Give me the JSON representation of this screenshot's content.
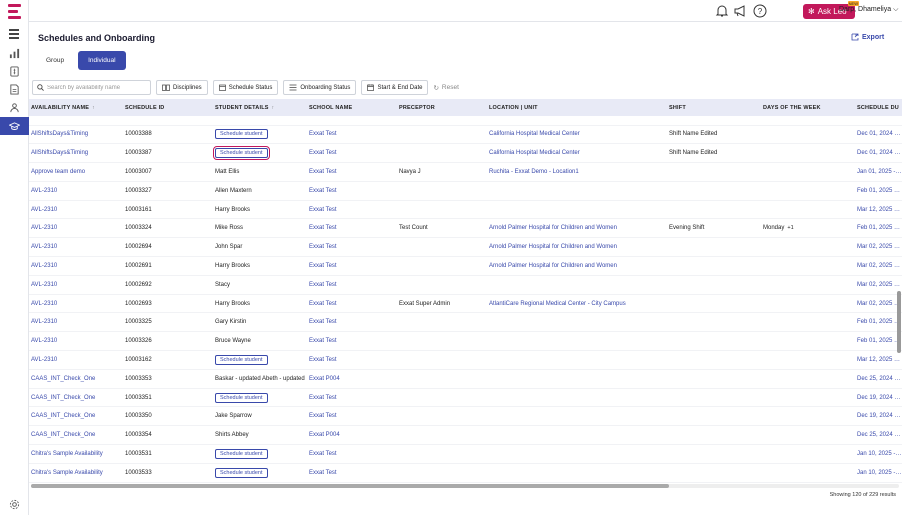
{
  "header": {
    "ask_leo_label": "Ask Leo",
    "ask_leo_badge": "NEW",
    "user_name": "Darp, Dhameliya"
  },
  "page": {
    "title": "Schedules and Onboarding",
    "export_label": "Export"
  },
  "tabs": [
    {
      "label": "Group",
      "active": false
    },
    {
      "label": "Individual",
      "active": true
    }
  ],
  "filters": {
    "search_placeholder": "Search by availability name",
    "disciplines": "Disciplines",
    "schedule_status": "Schedule Status",
    "onboarding_status": "Onboarding Status",
    "start_end_date": "Start & End Date",
    "reset": "Reset"
  },
  "table": {
    "columns": [
      "AVAILABILITY NAME",
      "SCHEDULE ID",
      "STUDENT DETAILS",
      "SCHOOL NAME",
      "PRECEPTOR",
      "LOCATION | UNIT",
      "SHIFT",
      "DAYS OF THE WEEK",
      "SCHEDULE DU"
    ],
    "schedule_button_label": "Schedule student",
    "rows": [
      {
        "availability": "AllShiftsDays&Timing",
        "id": "10003388",
        "student": "",
        "student_button": true,
        "focus": false,
        "school": "Exxat Test",
        "preceptor": "",
        "location": "California Hospital Medical Center",
        "shift": "Shift Name Edited",
        "days": "",
        "days_extra": "",
        "duration": "Dec 01, 2024 - Dec 31, 2024"
      },
      {
        "availability": "AllShiftsDays&Timing",
        "id": "10003387",
        "student": "",
        "student_button": true,
        "focus": true,
        "school": "Exxat Test",
        "preceptor": "",
        "location": "California Hospital Medical Center",
        "shift": "Shift Name Edited",
        "days": "",
        "days_extra": "",
        "duration": "Dec 01, 2024 - Dec 31, 2024"
      },
      {
        "availability": "Approve team demo",
        "id": "10003007",
        "student": "Matt Ellis",
        "student_button": false,
        "focus": false,
        "school": "Exxat Test",
        "preceptor": "Navya J",
        "location": "Ruchita - Exxat Demo - Location1",
        "shift": "",
        "days": "",
        "days_extra": "",
        "duration": "Jan 01, 2025 - Jan 31, 2025"
      },
      {
        "availability": "AVL-2310",
        "id": "10003327",
        "student": "Allen Maxtern",
        "student_button": false,
        "focus": false,
        "school": "Exxat Test",
        "preceptor": "",
        "location": "",
        "shift": "",
        "days": "",
        "days_extra": "",
        "duration": "Feb 01, 2025 - Feb 28, 2025"
      },
      {
        "availability": "AVL-2310",
        "id": "10003161",
        "student": "Harry Brooks",
        "student_button": false,
        "focus": false,
        "school": "Exxat Test",
        "preceptor": "",
        "location": "",
        "shift": "",
        "days": "",
        "days_extra": "",
        "duration": "Mar 12, 2025 - Apr 12, 2025"
      },
      {
        "availability": "AVL-2310",
        "id": "10003324",
        "student": "Mike Ross",
        "student_button": false,
        "focus": false,
        "school": "Exxat Test",
        "preceptor": "Test Count",
        "location": "Arnold Palmer Hospital for Children and Women",
        "shift": "Evening Shift",
        "days": "Monday",
        "days_extra": "+1",
        "duration": "Feb 01, 2025 - Feb 28, 2025"
      },
      {
        "availability": "AVL-2310",
        "id": "10002694",
        "student": "John Spar",
        "student_button": false,
        "focus": false,
        "school": "Exxat Test",
        "preceptor": "",
        "location": "Arnold Palmer Hospital for Children and Women",
        "shift": "",
        "days": "",
        "days_extra": "",
        "duration": "Mar 02, 2025 - Apr 02, 2025"
      },
      {
        "availability": "AVL-2310",
        "id": "10002691",
        "student": "Harry Brooks",
        "student_button": false,
        "focus": false,
        "school": "Exxat Test",
        "preceptor": "",
        "location": "Arnold Palmer Hospital for Children and Women",
        "shift": "",
        "days": "",
        "days_extra": "",
        "duration": "Mar 02, 2025 - Apr 02, 2025"
      },
      {
        "availability": "AVL-2310",
        "id": "10002692",
        "student": "Stacy",
        "student_button": false,
        "focus": false,
        "school": "Exxat Test",
        "preceptor": "",
        "location": "",
        "shift": "",
        "days": "",
        "days_extra": "",
        "duration": "Mar 02, 2025 - Apr 02, 2025"
      },
      {
        "availability": "AVL-2310",
        "id": "10002693",
        "student": "Harry Brooks",
        "student_button": false,
        "focus": false,
        "school": "Exxat Test",
        "preceptor": "Exxat Super Admin",
        "location": "AtlantiCare Regional Medical Center - City Campus",
        "shift": "",
        "days": "",
        "days_extra": "",
        "duration": "Mar 02, 2025 - Apr 02, 2025"
      },
      {
        "availability": "AVL-2310",
        "id": "10003325",
        "student": "Gary Kirstin",
        "student_button": false,
        "focus": false,
        "school": "Exxat Test",
        "preceptor": "",
        "location": "",
        "shift": "",
        "days": "",
        "days_extra": "",
        "duration": "Feb 01, 2025 - Feb 28, 2025"
      },
      {
        "availability": "AVL-2310",
        "id": "10003326",
        "student": "Bruce Wayne",
        "student_button": false,
        "focus": false,
        "school": "Exxat Test",
        "preceptor": "",
        "location": "",
        "shift": "",
        "days": "",
        "days_extra": "",
        "duration": "Feb 01, 2025 - Feb 28, 2025"
      },
      {
        "availability": "AVL-2310",
        "id": "10003162",
        "student": "",
        "student_button": true,
        "focus": false,
        "school": "Exxat Test",
        "preceptor": "",
        "location": "",
        "shift": "",
        "days": "",
        "days_extra": "",
        "duration": "Mar 12, 2025 - Apr 12, 2025"
      },
      {
        "availability": "CAAS_INT_Check_One",
        "id": "10003353",
        "student": "Baskar - updated Abeth - updated",
        "student_button": false,
        "focus": false,
        "school": "Exxat P004",
        "preceptor": "",
        "location": "",
        "shift": "",
        "days": "",
        "days_extra": "",
        "duration": "Dec 25, 2024 - Jan 25, 2025"
      },
      {
        "availability": "CAAS_INT_Check_One",
        "id": "10003351",
        "student": "",
        "student_button": true,
        "focus": false,
        "school": "Exxat Test",
        "preceptor": "",
        "location": "",
        "shift": "",
        "days": "",
        "days_extra": "",
        "duration": "Dec 19, 2024 - Jan 19, 2025"
      },
      {
        "availability": "CAAS_INT_Check_One",
        "id": "10003350",
        "student": "Jake Sparrow",
        "student_button": false,
        "focus": false,
        "school": "Exxat Test",
        "preceptor": "",
        "location": "",
        "shift": "",
        "days": "",
        "days_extra": "",
        "duration": "Dec 19, 2024 - Jan 19, 2025"
      },
      {
        "availability": "CAAS_INT_Check_One",
        "id": "10003354",
        "student": "Shirts Abbey",
        "student_button": false,
        "focus": false,
        "school": "Exxat P004",
        "preceptor": "",
        "location": "",
        "shift": "",
        "days": "",
        "days_extra": "",
        "duration": "Dec 25, 2024 - Jan 25, 2025"
      },
      {
        "availability": "Chitra's Sample Availability",
        "id": "10003531",
        "student": "",
        "student_button": true,
        "focus": false,
        "school": "Exxat Test",
        "preceptor": "",
        "location": "",
        "shift": "",
        "days": "",
        "days_extra": "",
        "duration": "Jan 10, 2025 - Feb 10, 2025"
      },
      {
        "availability": "Chitra's Sample Availability",
        "id": "10003533",
        "student": "",
        "student_button": true,
        "focus": false,
        "school": "Exxat Test",
        "preceptor": "",
        "location": "",
        "shift": "",
        "days": "",
        "days_extra": "",
        "duration": "Jan 10, 2025 - Feb 10, 2025"
      }
    ]
  },
  "footer": {
    "results_text": "Showing 120 of 229 results"
  },
  "colors": {
    "brand": "#c2185b",
    "accent": "#3949ab"
  }
}
